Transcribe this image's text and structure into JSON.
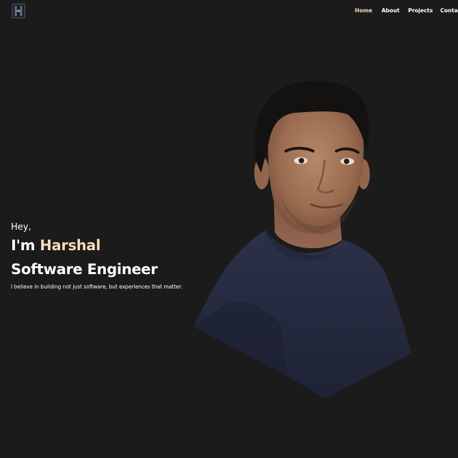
{
  "header": {
    "logo_icon": "h-monogram-icon",
    "nav": [
      {
        "label": "Home",
        "active": true
      },
      {
        "label": "About",
        "active": false
      },
      {
        "label": "Projects",
        "active": false
      },
      {
        "label": "Contact",
        "active": false
      }
    ]
  },
  "hero": {
    "greeting": "Hey,",
    "name_prefix": "I'm ",
    "name": "Harshal",
    "role": "Software Engineer",
    "tagline": "I believe in building not just software, but experiences that matter."
  },
  "colors": {
    "background": "#1b1b1b",
    "accent": "#f3dcb8",
    "text": "#ffffff"
  },
  "portrait": {
    "icon": "profile-photo"
  }
}
